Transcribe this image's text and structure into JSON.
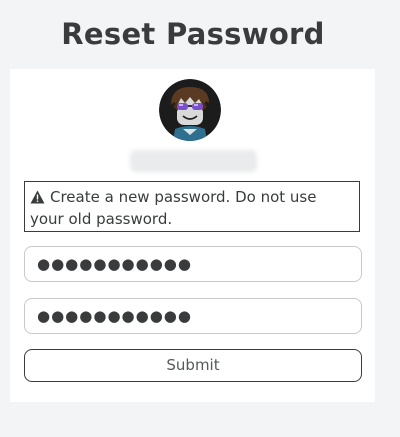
{
  "header": {
    "title": "Reset Password"
  },
  "profile": {
    "avatar_icon": "user-avatar-icon",
    "username": ""
  },
  "alert": {
    "icon": "warning-icon",
    "message": "Create a new password. Do not use your old password."
  },
  "form": {
    "new_password_value": "●●●●●●●●●●●",
    "confirm_password_value": "●●●●●●●●●●●",
    "submit_label": "Submit"
  },
  "colors": {
    "page_background": "#f2f4f5",
    "card_background": "#ffffff",
    "text": "#393b3d",
    "field_border": "#c7c9ca"
  }
}
